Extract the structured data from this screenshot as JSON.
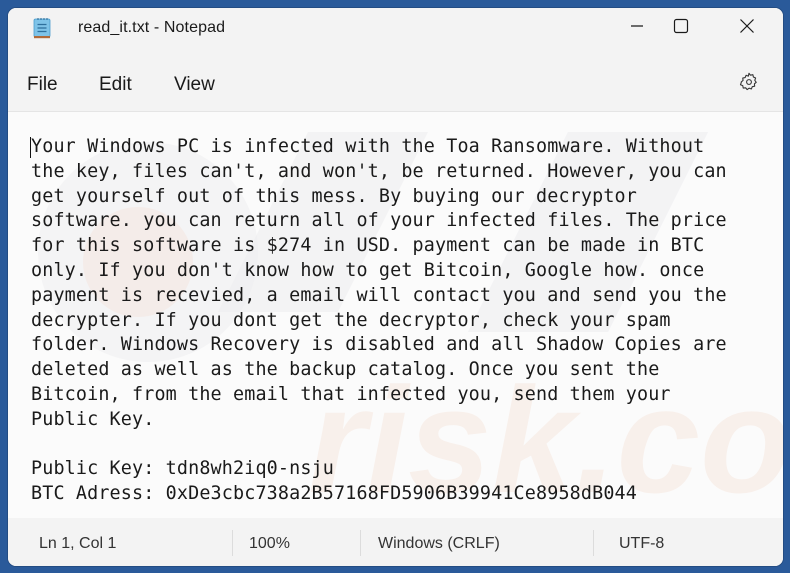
{
  "window": {
    "title": "read_it.txt - Notepad",
    "app_icon": "notepad-icon",
    "controls": {
      "minimize": "minimize-icon",
      "maximize": "maximize-icon",
      "close": "close-icon"
    }
  },
  "menubar": {
    "items": [
      {
        "label": "File"
      },
      {
        "label": "Edit"
      },
      {
        "label": "View"
      }
    ],
    "settings_icon": "gear-icon"
  },
  "editor": {
    "lines": [
      "Your Windows PC is infected with the Toa Ransomware. Without",
      "the key, files can't, and won't, be returned. However, you can",
      "get yourself out of this mess. By buying our decryptor",
      "software. you can return all of your infected files. The price",
      "for this software is $274 in USD. payment can be made in BTC",
      "only. If you don't know how to get Bitcoin, Google how. once",
      "payment is recevied, a email will contact you and send you the",
      "decrypter. If you dont get the decryptor, check your spam",
      "folder. Windows Recovery is disabled and all Shadow Copies are",
      "deleted as well as the backup catalog. Once you sent the",
      "Bitcoin, from the email that infected you, send them your",
      "Public Key.",
      "",
      "Public Key: tdn8wh2iq0-nsju",
      "BTC Adress: 0xDe3cbc738a2B57168FD5906B39941Ce8958dB044"
    ]
  },
  "statusbar": {
    "position": "Ln 1, Col 1",
    "zoom": "100%",
    "line_ending": "Windows (CRLF)",
    "encoding": "UTF-8"
  },
  "colors": {
    "desktop": "#2a5a9a",
    "window_bg": "#f3f3f3",
    "editor_bg": "#fbfbfb",
    "text": "#1a1a1a"
  }
}
